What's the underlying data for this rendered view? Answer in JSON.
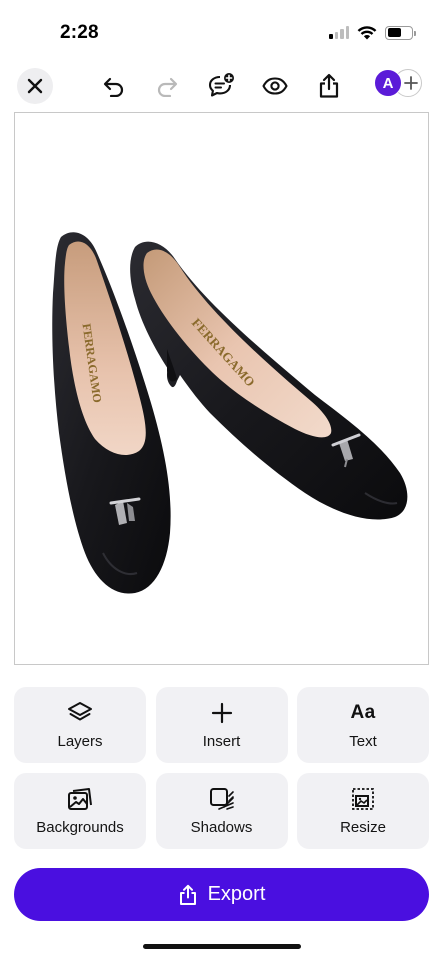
{
  "status_bar": {
    "time": "2:28",
    "signal_bars_active": 1,
    "battery_level": 0.58
  },
  "toolbar": {
    "close_icon": "close-icon",
    "undo_icon": "undo-icon",
    "redo_icon": "redo-icon",
    "comment_icon": "comment-add-icon",
    "preview_icon": "eye-icon",
    "share_icon": "share-icon",
    "avatar_initial": "A",
    "add_collaborator_icon": "plus-icon"
  },
  "canvas": {
    "image_subject": "pair of black leather pumps",
    "logo_text": "FERRAGAMO"
  },
  "tools": [
    {
      "label": "Layers",
      "icon": "layers-icon"
    },
    {
      "label": "Insert",
      "icon": "plus-icon"
    },
    {
      "label": "Text",
      "icon": "text-aa-icon",
      "glyph": "Aa"
    },
    {
      "label": "Backgrounds",
      "icon": "backgrounds-icon"
    },
    {
      "label": "Shadows",
      "icon": "shadows-icon"
    },
    {
      "label": "Resize",
      "icon": "resize-icon"
    }
  ],
  "export": {
    "label": "Export",
    "icon": "share-icon"
  },
  "colors": {
    "accent": "#4a0fe0",
    "avatar": "#5b1bd8",
    "tile_bg": "#f1f1f4"
  }
}
